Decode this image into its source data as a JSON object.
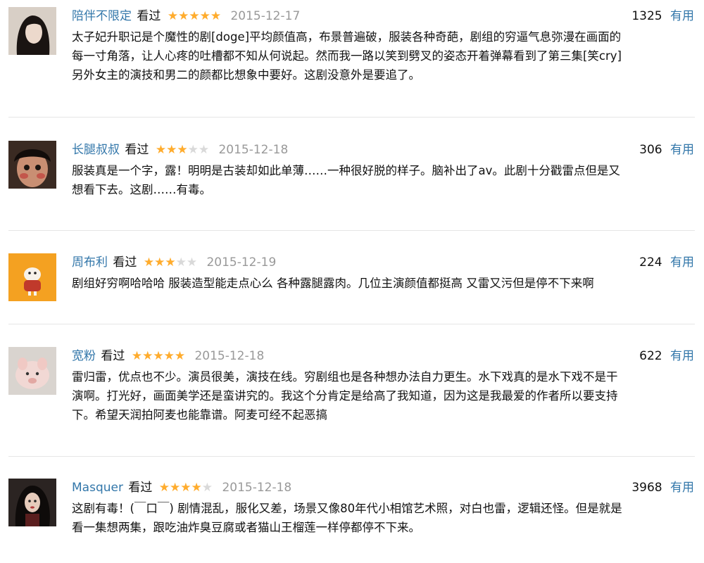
{
  "reviews": [
    {
      "user": "陪伴不限定",
      "watched": "看过",
      "rating": 5,
      "date": "2015-12-17",
      "votes": "1325",
      "useful": "有用",
      "text": "太子妃升职记是个魔性的剧[doge]平均颜值高，布景普遍破，服装各种奇葩，剧组的穷逼气息弥漫在画面的\n每一寸角落，让人心疼的吐槽都不知从何说起。然而我一路以笑到劈叉的姿态开着弹幕看到了第三集[笑cry]\n另外女主的演技和男二的颜都比想象中要好。这剧没意外是要追了。"
    },
    {
      "user": "长腿叔叔",
      "watched": "看过",
      "rating": 3,
      "date": "2015-12-18",
      "votes": "306",
      "useful": "有用",
      "text": "服装真是一个字，露！明明是古装却如此单薄……一种很好脱的样子。脑补出了av。此剧十分戳雷点但是又\n想看下去。这剧……有毒。"
    },
    {
      "user": "周布利",
      "watched": "看过",
      "rating": 3,
      "date": "2015-12-19",
      "votes": "224",
      "useful": "有用",
      "text": "剧组好穷啊哈哈哈 服装造型能走点心么 各种露腿露肉。几位主演颜值都挺高 又雷又污但是停不下来啊"
    },
    {
      "user": "宽粉",
      "watched": "看过",
      "rating": 5,
      "date": "2015-12-18",
      "votes": "622",
      "useful": "有用",
      "text": "雷归雷，优点也不少。演员很美，演技在线。穷剧组也是各种想办法自力更生。水下戏真的是水下戏不是干\n演啊。打光好，画面美学还是蛮讲究的。我这个分肯定是给高了我知道，因为这是我最爱的作者所以要支持\n下。希望天润拍阿麦也能靠谱。阿麦可经不起恶搞"
    },
    {
      "user": "Masquer",
      "watched": "看过",
      "rating": 4,
      "date": "2015-12-18",
      "votes": "3968",
      "useful": "有用",
      "text": "这剧有毒！(￣口￣) 剧情混乱，服化又差，场景又像80年代小相馆艺术照，对白也雷，逻辑还怪。但是就是\n看一集想两集，跟吃油炸臭豆腐或者猫山王榴莲一样停都停不下来。"
    }
  ],
  "icons": [
    "star-icon"
  ],
  "colors": {
    "link": "#3377aa",
    "star": "#ffac2d",
    "star_off": "#d9d9d9",
    "date": "#999999",
    "divider": "#e6e6e6"
  }
}
